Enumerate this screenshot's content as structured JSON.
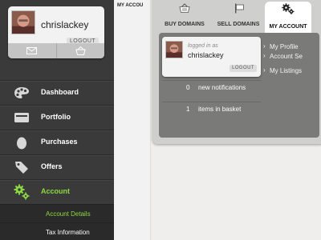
{
  "sidebar": {
    "username": "chrislackey",
    "logout_label": "LOGOUT",
    "card_actions": [
      {
        "icon": "mail-icon"
      },
      {
        "icon": "basket-icon"
      }
    ],
    "nav": [
      {
        "label": "Dashboard",
        "icon": "palette-icon"
      },
      {
        "label": "Portfolio",
        "icon": "folder-icon"
      },
      {
        "label": "Purchases",
        "icon": "egg-icon"
      },
      {
        "label": "Offers",
        "icon": "tag-icon"
      },
      {
        "label": "Account",
        "icon": "gears-icon",
        "active": true
      }
    ],
    "subnav": [
      {
        "label": "Account Details",
        "active": true
      },
      {
        "label": "Tax Information"
      }
    ]
  },
  "strip": {
    "tab_text": "MY ACCOU"
  },
  "panel": {
    "tabs": [
      {
        "label": "BUY DOMAINS",
        "icon": "basket-icon"
      },
      {
        "label": "SELL DOMAINS",
        "icon": "sign-icon"
      },
      {
        "label": "MY ACCOUNT",
        "icon": "gears-icon",
        "active": true
      }
    ],
    "user": {
      "logged_in_as": "logged in as",
      "username": "chrislackey",
      "logout_label": "LOGOUT"
    },
    "stats": [
      {
        "count": "0",
        "label": "new notifications"
      },
      {
        "count": "1",
        "label": "items in basket"
      }
    ],
    "links": [
      "My Profile",
      "Account Se",
      "My Listings"
    ]
  },
  "colors": {
    "sidebar_bg": "#3a3a3a",
    "active_green": "#8dd842",
    "panel_bg": "#cfcfcd",
    "panel_inner": "#7a7a78",
    "page_bg": "#efeeec"
  }
}
